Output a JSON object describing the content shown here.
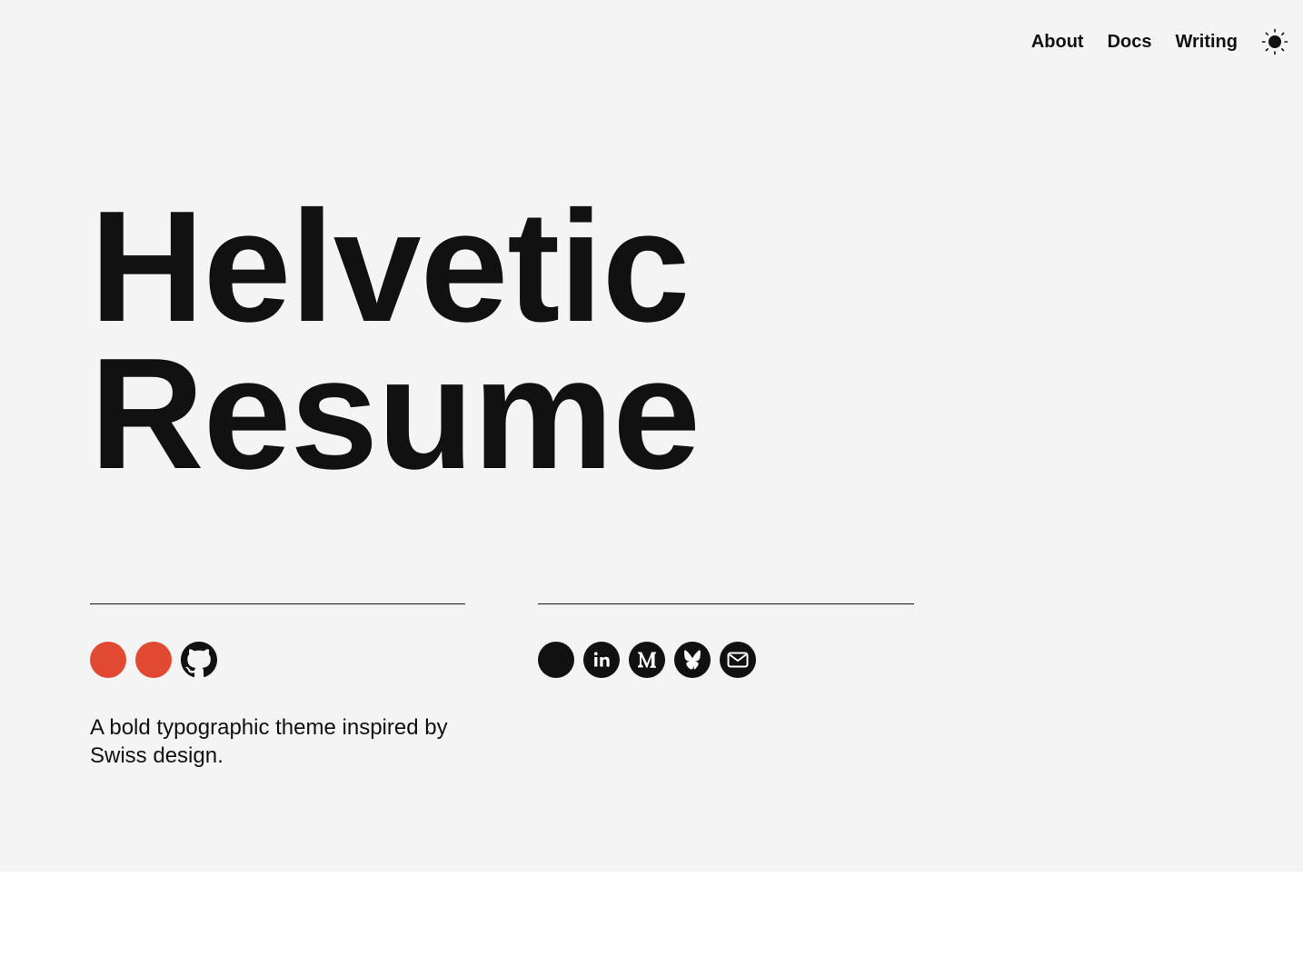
{
  "nav": {
    "items": [
      {
        "label": "About"
      },
      {
        "label": "Docs"
      },
      {
        "label": "Writing"
      }
    ],
    "theme_toggle_icon": "sun-icon"
  },
  "hero": {
    "line1": "Helvetic",
    "line2": "Resume"
  },
  "left": {
    "icons": [
      {
        "name": "red-dot-icon",
        "color": "#e04a32"
      },
      {
        "name": "red-dot-icon",
        "color": "#e04a32"
      },
      {
        "name": "github-icon",
        "color": "#111111"
      }
    ],
    "tagline": "A bold typographic theme inspired by Swiss design."
  },
  "right": {
    "icons": [
      {
        "name": "black-dot-icon",
        "color": "#111111"
      },
      {
        "name": "linkedin-icon",
        "color": "#111111"
      },
      {
        "name": "medium-icon",
        "color": "#111111"
      },
      {
        "name": "bluesky-icon",
        "color": "#111111"
      },
      {
        "name": "email-icon",
        "color": "#111111"
      }
    ]
  },
  "colors": {
    "background": "#f4f4f4",
    "text": "#111111",
    "accent": "#e04a32"
  }
}
